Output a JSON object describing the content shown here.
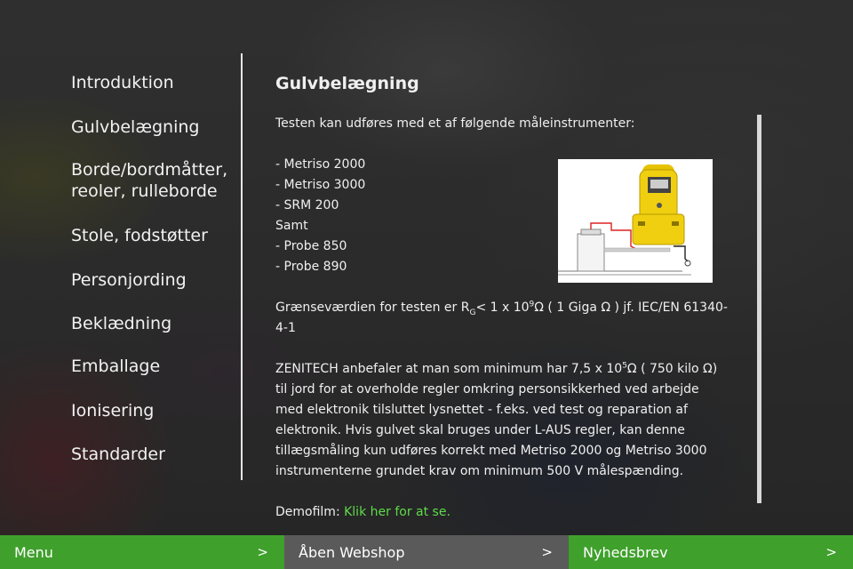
{
  "sidebar": {
    "items": [
      {
        "label": "Introduktion"
      },
      {
        "label": "Gulvbelægning"
      },
      {
        "label_line1": "Borde/bordmåtter,",
        "label_line2": "reoler, rulleborde"
      },
      {
        "label": "Stole, fodstøtter"
      },
      {
        "label": "Personjording"
      },
      {
        "label": "Beklædning"
      },
      {
        "label": "Emballage"
      },
      {
        "label": "Ionisering"
      },
      {
        "label": "Standarder"
      }
    ]
  },
  "main": {
    "title": "Gulvbelægning",
    "intro": "Testen kan udføres med et af følgende måleinstrumenter:",
    "instruments": [
      "- Metriso 2000",
      "- Metriso 3000",
      "- SRM 200",
      "Samt",
      "- Probe 850",
      "- Probe 890"
    ],
    "limit": {
      "prefix": "Grænseværdien for testen er R",
      "sub": "G",
      "mid": "< 1 x 10",
      "sup": "9",
      "suffix": "Ω ( 1 Giga Ω ) jf. IEC/EN 61340-4-1"
    },
    "recommendation": {
      "prefix": "ZENITECH anbefaler at man som minimum har 7,5 x 10",
      "sup": "5",
      "suffix": "Ω ( 750 kilo Ω) til jord for at overholde regler omkring personsikkerhed ved arbejde med elektronik tilsluttet lysnettet - f.eks. ved test og reparation af elektronik. Hvis gulvet skal bruges under L-AUS regler, kan denne tillægsmåling kun udføres korrekt med Metriso 2000 og Metriso 3000 instrumenterne grundet krav om minimum 500 V målespænding."
    },
    "demo_label": "Demofilm: ",
    "demo_link": "Klik her for at se."
  },
  "bottom_bar": {
    "menu_label": "Menu",
    "webshop_label": "Åben Webshop",
    "newsletter_label": "Nyhedsbrev",
    "chevron": ">"
  },
  "colors": {
    "green_bar": "#3fa02c",
    "grey_bar": "#5a5a5a",
    "link_green": "#5fdc4a"
  },
  "icons": {
    "product_image": "metriso-meter-test-setup"
  }
}
